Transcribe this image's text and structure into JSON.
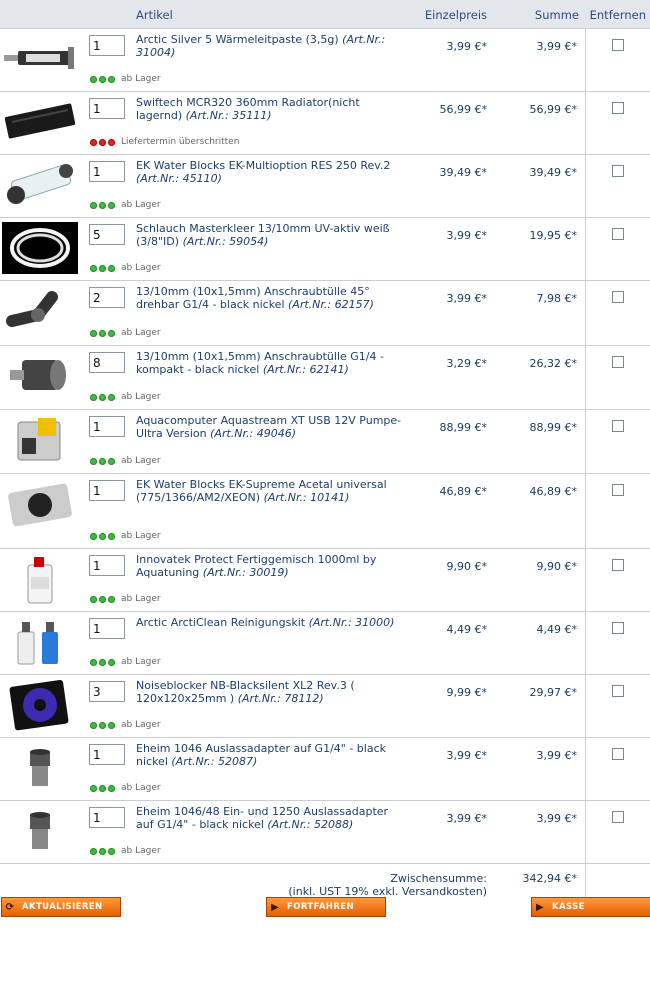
{
  "header": {
    "artikel": "Artikel",
    "einzelpreis": "Einzelpreis",
    "summe": "Summe",
    "entfernen": "Entfernen"
  },
  "items": [
    {
      "qty": "1",
      "name": "Arctic Silver 5 Wärmeleitpaste (3,5g)",
      "artnr": "(Art.Nr.: 31004)",
      "price": "3,99 €*",
      "sum": "3,99 €*",
      "stock": "ab Lager",
      "stock_color": "green",
      "image": "thermal-paste-syringe"
    },
    {
      "qty": "1",
      "name": "Swiftech MCR320 360mm Radiator(nicht lagernd)",
      "artnr": "(Art.Nr.: 35111)",
      "price": "56,99 €*",
      "sum": "56,99 €*",
      "stock": "Liefertermin überschritten",
      "stock_color": "red",
      "image": "radiator"
    },
    {
      "qty": "1",
      "name": "EK Water Blocks EK-Multioption RES 250 Rev.2",
      "artnr": "(Art.Nr.: 45110)",
      "price": "39,49 €*",
      "sum": "39,49 €*",
      "stock": "ab Lager",
      "stock_color": "green",
      "image": "reservoir-tube"
    },
    {
      "qty": "5",
      "name": "Schlauch Masterkleer 13/10mm UV-aktiv weiß (3/8\"ID)",
      "artnr": "(Art.Nr.: 59054)",
      "price": "3,99 €*",
      "sum": "19,95 €*",
      "stock": "ab Lager",
      "stock_color": "green",
      "image": "hose-coil"
    },
    {
      "qty": "2",
      "name": "13/10mm (10x1,5mm) Anschraubtülle 45° drehbar G1/4 - black nickel",
      "artnr": "(Art.Nr.: 62157)",
      "price": "3,99 €*",
      "sum": "7,98 €*",
      "stock": "ab Lager",
      "stock_color": "green",
      "image": "fitting-45-degree"
    },
    {
      "qty": "8",
      "name": "13/10mm (10x1,5mm) Anschraubtülle G1/4 - kompakt - black nickel",
      "artnr": "(Art.Nr.: 62141)",
      "price": "3,29 €*",
      "sum": "26,32 €*",
      "stock": "ab Lager",
      "stock_color": "green",
      "image": "fitting-compact"
    },
    {
      "qty": "1",
      "name": "Aquacomputer Aquastream XT USB 12V Pumpe- Ultra Version",
      "artnr": "(Art.Nr.: 49046)",
      "price": "88,99 €*",
      "sum": "88,99 €*",
      "stock": "ab Lager",
      "stock_color": "green",
      "image": "pump"
    },
    {
      "qty": "1",
      "name": "EK Water Blocks EK-Supreme Acetal universal (775/1366/AM2/XEON)",
      "artnr": "(Art.Nr.: 10141)",
      "price": "46,89 €*",
      "sum": "46,89 €*",
      "stock": "ab Lager",
      "stock_color": "green",
      "image": "cpu-waterblock"
    },
    {
      "qty": "1",
      "name": "Innovatek Protect Fertiggemisch 1000ml by Aquatuning",
      "artnr": "(Art.Nr.: 30019)",
      "price": "9,90 €*",
      "sum": "9,90 €*",
      "stock": "ab Lager",
      "stock_color": "green",
      "image": "coolant-bottle"
    },
    {
      "qty": "1",
      "name": "Arctic ArctiClean Reinigungskit",
      "artnr": "(Art.Nr.: 31000)",
      "price": "4,49 €*",
      "sum": "4,49 €*",
      "stock": "ab Lager",
      "stock_color": "green",
      "image": "cleaning-bottles"
    },
    {
      "qty": "3",
      "name": "Noiseblocker NB-Blacksilent XL2 Rev.3 ( 120x120x25mm )",
      "artnr": "(Art.Nr.: 78112)",
      "price": "9,99 €*",
      "sum": "29,97 €*",
      "stock": "ab Lager",
      "stock_color": "green",
      "image": "case-fan"
    },
    {
      "qty": "1",
      "name": "Eheim 1046 Auslassadapter auf G1/4\" - black nickel",
      "artnr": "(Art.Nr.: 52087)",
      "price": "3,99 €*",
      "sum": "3,99 €*",
      "stock": "ab Lager",
      "stock_color": "green",
      "image": "adapter-fitting"
    },
    {
      "qty": "1",
      "name": "Eheim 1046/48 Ein- und 1250 Auslassadapter auf G1/4\" - black nickel",
      "artnr": "(Art.Nr.: 52088)",
      "price": "3,99 €*",
      "sum": "3,99 €*",
      "stock": "ab Lager",
      "stock_color": "green",
      "image": "adapter-fitting"
    }
  ],
  "subtotal": {
    "label": "Zwischensumme:",
    "note_prefix": "(inkl. UST 19% exkl. ",
    "note_link": "Versandkosten",
    "note_suffix": ")",
    "value": "342,94 €*"
  },
  "buttons": {
    "update": "AKTUALISIEREN",
    "continue": "FORTFAHREN",
    "checkout": "KASSE"
  },
  "colors": {
    "header_bg": "#e3e7ec",
    "text": "#1d3e6c",
    "button_orange": "#ff8a1e",
    "stock_green": "#3dbb3d",
    "stock_red": "#e02323"
  }
}
